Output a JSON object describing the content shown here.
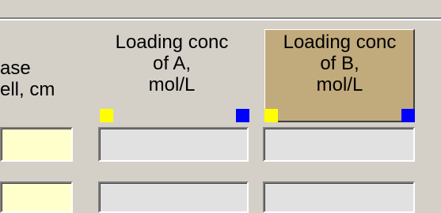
{
  "header": {
    "partial_column_label": "ase\nell, cm",
    "column_a_label": "Loading conc\nof A,\nmol/L",
    "column_b_label": "Loading conc\nof B,\nmol/L"
  },
  "colors": {
    "selected_header_bg": "#c1aa7c",
    "marker_yellow": "#ffff00",
    "marker_blue": "#0000ff",
    "input_yellow": "#ffffcc",
    "input_gray": "#e1e1e1"
  },
  "rows": [
    {
      "partial": "",
      "a": "",
      "b": ""
    },
    {
      "partial": "",
      "a": "",
      "b": ""
    }
  ]
}
